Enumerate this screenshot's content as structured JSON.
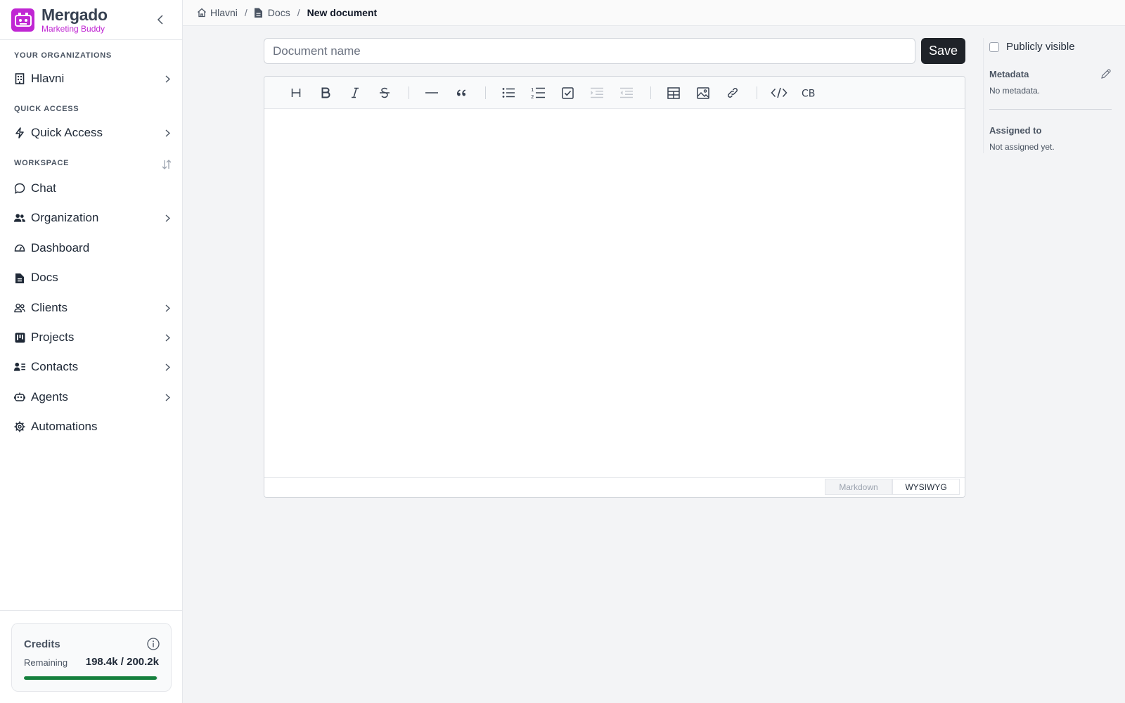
{
  "brand": {
    "title": "Mergado",
    "subtitle": "Marketing Buddy",
    "accent": "#c026d3"
  },
  "sidebar": {
    "sections": [
      {
        "label": "YOUR ORGANIZATIONS"
      },
      {
        "label": "QUICK ACCESS"
      },
      {
        "label": "WORKSPACE"
      }
    ],
    "items": [
      {
        "label": "Hlavni",
        "icon": "building-icon",
        "has_submenu": true
      },
      {
        "label": "Quick Access",
        "icon": "bolt-icon",
        "has_submenu": true
      },
      {
        "label": "Chat",
        "icon": "chat-icon",
        "has_submenu": false
      },
      {
        "label": "Organization",
        "icon": "users-icon",
        "has_submenu": true
      },
      {
        "label": "Dashboard",
        "icon": "gauge-icon",
        "has_submenu": false
      },
      {
        "label": "Docs",
        "icon": "document-icon",
        "has_submenu": false
      },
      {
        "label": "Clients",
        "icon": "user-group-icon",
        "has_submenu": true
      },
      {
        "label": "Projects",
        "icon": "kanban-icon",
        "has_submenu": true
      },
      {
        "label": "Contacts",
        "icon": "contact-list-icon",
        "has_submenu": true
      },
      {
        "label": "Agents",
        "icon": "robot-icon",
        "has_submenu": true
      },
      {
        "label": "Automations",
        "icon": "gear-icon",
        "has_submenu": false
      }
    ]
  },
  "credits": {
    "title": "Credits",
    "remaining_label": "Remaining",
    "value": "198.4k / 200.2k",
    "fraction": 0.991,
    "bar_color": "#15803d"
  },
  "breadcrumb": {
    "items": [
      {
        "label": "Hlavni",
        "icon": "home-icon"
      },
      {
        "label": "Docs",
        "icon": "document-icon"
      }
    ],
    "current": "New document",
    "separator": "/"
  },
  "editor": {
    "name_placeholder": "Document name",
    "name_value": "",
    "save_label": "Save",
    "toolbar": [
      "heading-icon",
      "bold-icon",
      "italic-icon",
      "strikethrough-icon",
      "horizontal-rule-icon",
      "quote-icon",
      "bullet-list-icon",
      "ordered-list-icon",
      "task-list-icon",
      "indent-icon",
      "outdent-icon",
      "table-icon",
      "image-icon",
      "link-icon",
      "code-icon",
      "code-block-icon"
    ],
    "code_block_glyph": "CB",
    "modes": [
      "Markdown",
      "WYSIWYG"
    ],
    "active_mode": "WYSIWYG"
  },
  "panel": {
    "public_label": "Publicly visible",
    "public_checked": false,
    "metadata_title": "Metadata",
    "metadata_value": "No metadata.",
    "assigned_title": "Assigned to",
    "assigned_value": "Not assigned yet."
  }
}
